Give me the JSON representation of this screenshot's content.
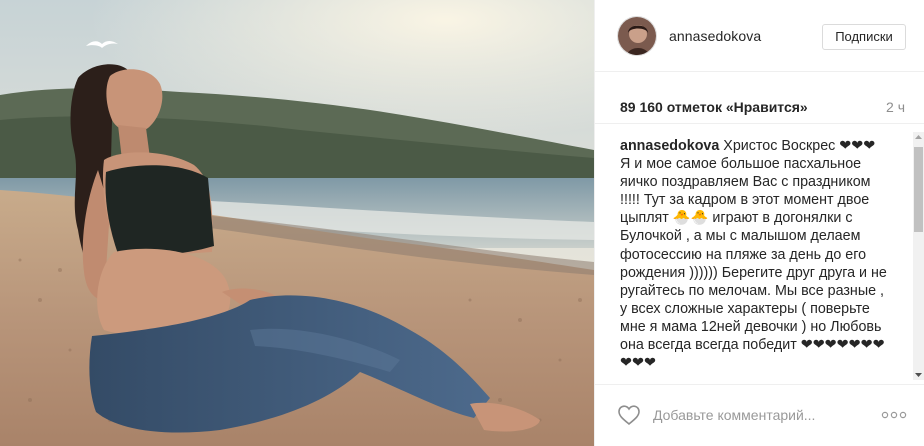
{
  "post": {
    "username": "annasedokova",
    "follow_label": "Подписки",
    "likes_text": "89 160 отметок «Нравится»",
    "time_ago": "2 ч",
    "caption_user": "annasedokova",
    "caption_text": " Христос Воскрес ❤❤❤\nЯ и мое самое большое пасхальное яичко поздравляем Вас с праздником !!!!! Тут за кадром в этот момент двое цыплят 🐣🐣 играют в догонялки с Булочкой , а мы с малышом делаем фотосессию на пляже за день до его рождения )))))) Берегите друг друга и не ругайтесь по мелочам. Мы все разные , у всех сложные характеры ( поверьте мне я мама 12ней девочки ) но Любовь она всегда всегда победит ❤❤❤❤❤❤❤❤❤❤",
    "comment_placeholder": "Добавьте комментарий..."
  },
  "icons": {
    "like": "heart-outline-icon",
    "more": "more-options-icon"
  },
  "colors": {
    "text": "#262626",
    "muted": "#8e8e8e",
    "border": "#dbdbdb"
  }
}
